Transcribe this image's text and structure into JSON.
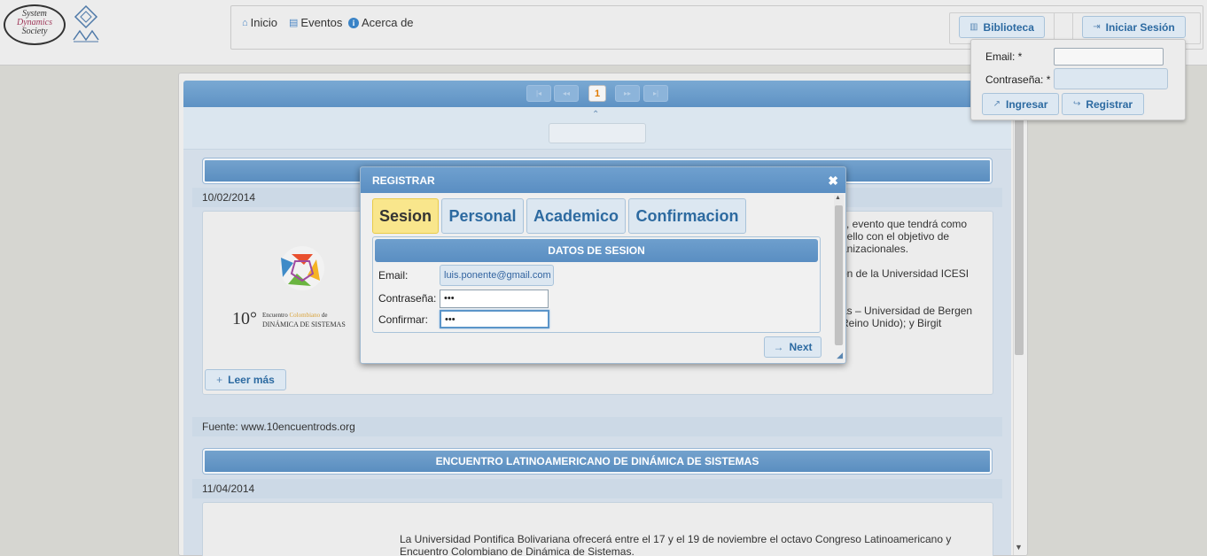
{
  "header": {
    "logo": {
      "line1": "System",
      "line2": "Dynamics",
      "line3": "Society"
    },
    "nav": [
      {
        "label": "Inicio",
        "icon": "home-icon"
      },
      {
        "label": "Eventos",
        "icon": "calendar-icon"
      },
      {
        "label": "Acerca de",
        "icon": "info-icon"
      }
    ],
    "biblioteca_label": "Biblioteca",
    "login_label": "Iniciar Sesión"
  },
  "login_popup": {
    "email_label": "Email: *",
    "password_label": "Contraseña: *",
    "submit_label": "Ingresar",
    "register_label": "Registrar"
  },
  "pager": {
    "current": "1"
  },
  "events": [
    {
      "title": "",
      "date": "10/02/2014",
      "logo": {
        "number": "10°",
        "line1a": "Encuentro ",
        "line1b": "Colombiano",
        "line1c": " de",
        "line2": "Dinámica de Sistemas"
      },
      "text_lines": [
        "s, evento que tendrá como",
        ", ello con el objetivo de",
        "anizacionales.",
        "",
        "ón de la Universidad ICESI",
        "",
        "",
        "as – Universidad de Bergen",
        "Reino Unido); y Birgit"
      ],
      "read_more": "Leer más",
      "source": "Fuente: www.10encuentrods.org"
    },
    {
      "title": "ENCUENTRO LATINOAMERICANO DE DINÁMICA DE SISTEMAS",
      "date": "11/04/2014",
      "text_lines": [
        "La Universidad Pontifica Bolivariana ofrecerá entre el 17 y el 19 de noviembre el octavo Congreso Latinoamericano y",
        "Encuentro Colombiano de Dinámica de Sistemas."
      ]
    }
  ],
  "modal": {
    "title": "REGISTRAR",
    "tabs": [
      "Sesion",
      "Personal",
      "Academico",
      "Confirmacion"
    ],
    "active_tab": "Sesion",
    "section_title": "DATOS DE SESION",
    "fields": {
      "email_label": "Email:",
      "email_value": "luis.ponente@gmail.com",
      "password_label": "Contraseña:",
      "password_value": "•••",
      "confirm_label": "Confirmar:",
      "confirm_value": "•••"
    },
    "next_label": "Next"
  },
  "colors": {
    "accent": "#5a8ec2",
    "active_tab": "#f9e68c",
    "page_number": "#e07a00"
  }
}
